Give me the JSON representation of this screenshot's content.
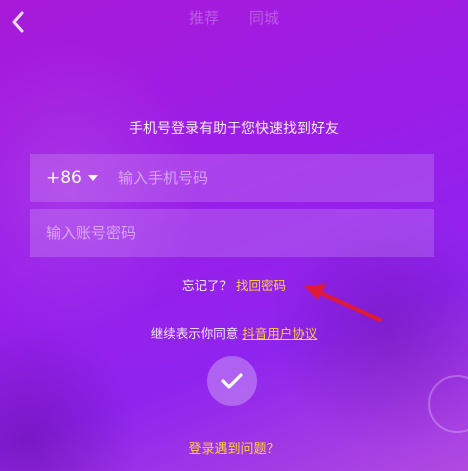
{
  "nav": {
    "back_icon": "chevron-left-icon",
    "tabs": [
      "推荐",
      "同城"
    ]
  },
  "login": {
    "hint": "手机号登录有助于您快速找到好友",
    "country_code": "+86",
    "phone_placeholder": "输入手机号码",
    "password_placeholder": "输入账号密码",
    "forgot_question": "忘记了？",
    "forgot_link": "找回密码",
    "agree_text": "继续表示你同意",
    "agree_link": "抖音用户协议",
    "submit_icon": "checkmark-icon",
    "problem_link": "登录遇到问题？"
  },
  "colors": {
    "background": "#9a1ee8",
    "link": "#ffd33a",
    "annotation_arrow": "#e01a36"
  }
}
